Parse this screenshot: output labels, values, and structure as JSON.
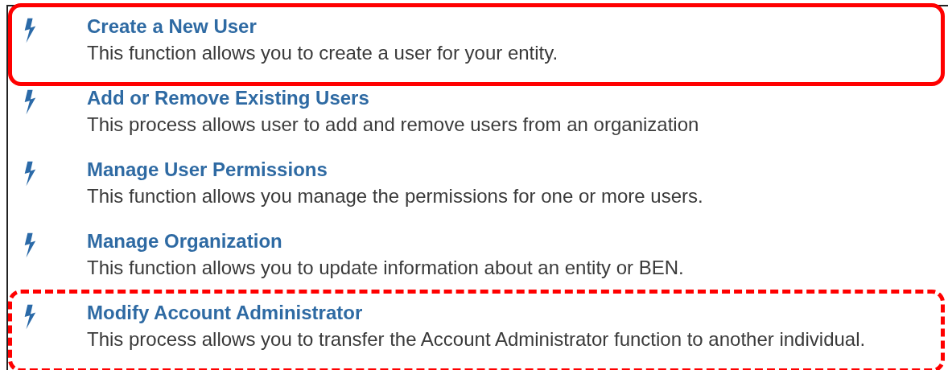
{
  "items": [
    {
      "title": "Create a New User",
      "description": "This function allows you to create a user for your entity.",
      "kind": "solid"
    },
    {
      "title": "Add or Remove Existing Users",
      "description": "This process allows user to add and remove users from an organization",
      "kind": "plain"
    },
    {
      "title": "Manage User Permissions",
      "description": "This function allows you manage the permissions for one or more users.",
      "kind": "plain"
    },
    {
      "title": "Manage Organization",
      "description": "This function allows you to update information about an entity or BEN.",
      "kind": "plain"
    },
    {
      "title": "Modify Account Administrator",
      "description": "This process allows you to transfer the Account Administrator function to another individual.",
      "kind": "dashed"
    }
  ]
}
